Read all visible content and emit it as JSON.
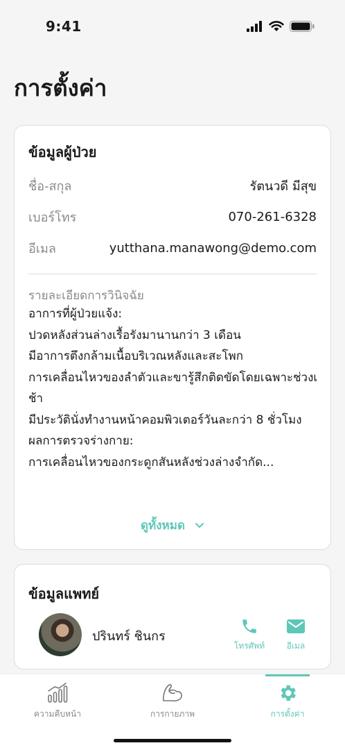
{
  "status_bar": {
    "time": "9:41"
  },
  "page": {
    "title": "การตั้งค่า"
  },
  "patient": {
    "title": "ข้อมูลผู้ป่วย",
    "name_label": "ชื่อ-สกุล",
    "name_value": "รัตนวดี มีสุข",
    "phone_label": "เบอร์โทร",
    "phone_value": "070-261-6328",
    "email_label": "อีเมล",
    "email_value": "yutthana.manawong@demo.com",
    "diagnosis_label": "รายละเอียดการวินิจฉัย",
    "diagnosis_text": "อาการที่ผู้ป่วยแจ้ง:\nปวดหลังส่วนล่างเรื้อรังมานานกว่า 3 เดือน\nมีอาการตึงกล้ามเนื้อบริเวณหลังและสะโพก\nการเคลื่อนไหวของลำตัวและขารู้สึกติดขัดโดยเฉพาะช่วงเช้า\nมีประวัตินั่งทำงานหน้าคอมพิวเตอร์วันละกว่า 8 ชั่วโมง\nผลการตรวจร่างกาย:\nการเคลื่อนไหวของกระดูกสันหลังช่วงล่างจำกัด...",
    "view_all_label": "ดูทั้งหมด"
  },
  "doctor": {
    "title": "ข้อมูลแพทย์",
    "name": "ปรินทร์ ชินกร",
    "phone_label": "โทรศัพท์",
    "email_label": "อีเมล"
  },
  "tabs": [
    {
      "label": "ความคืบหน้า",
      "icon": "progress-chart-icon",
      "active": false
    },
    {
      "label": "การกายภาพ",
      "icon": "arm-muscle-icon",
      "active": false
    },
    {
      "label": "การตั้งค่า",
      "icon": "gear-icon",
      "active": true
    }
  ],
  "colors": {
    "accent": "#5fc7b8",
    "text": "#1a1a1a",
    "muted": "#8a8a8a",
    "background": "#f5f5f5"
  }
}
